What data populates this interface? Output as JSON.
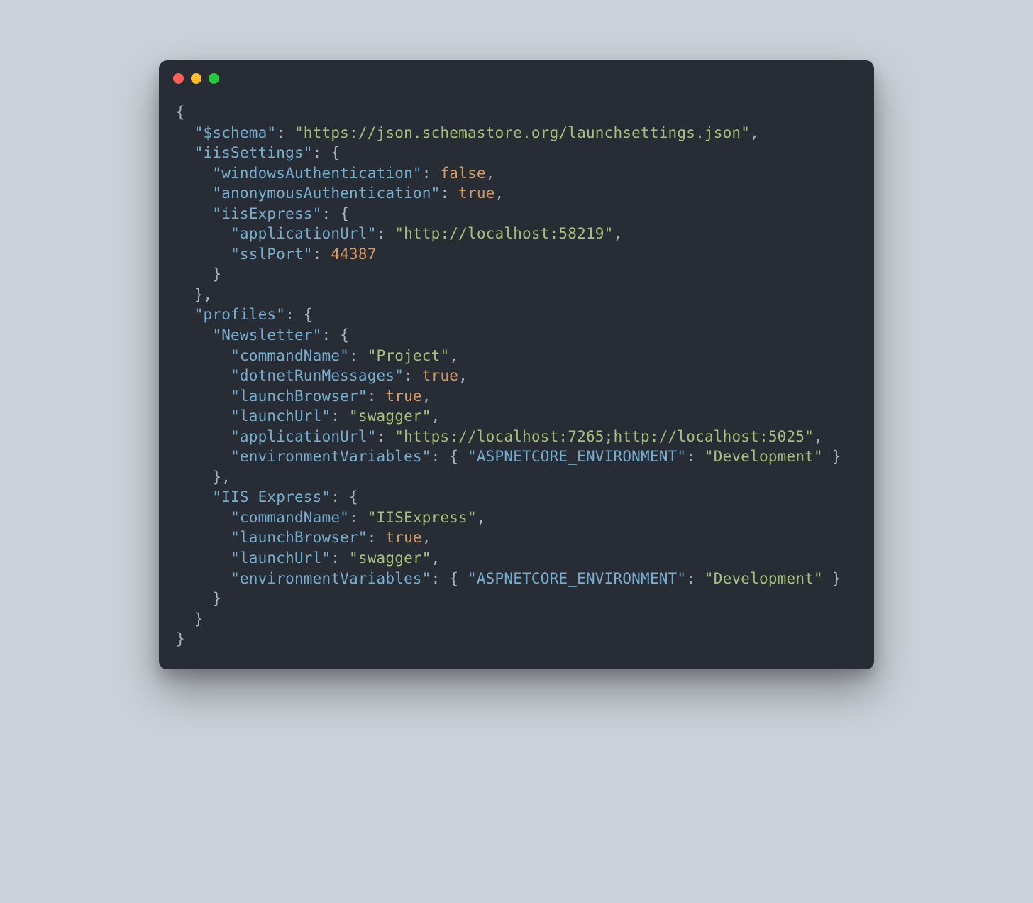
{
  "window": {
    "dots": [
      "red",
      "yellow",
      "green"
    ]
  },
  "code": {
    "ind1": "  ",
    "ind2": "    ",
    "ind3": "      ",
    "brace_open": "{",
    "brace_close": "}",
    "bracket_content_open": "{ ",
    "bracket_content_close": " }",
    "colon_space": ": ",
    "comma": ",",
    "keys": {
      "schema": "\"$schema\"",
      "iisSettings": "\"iisSettings\"",
      "windowsAuthentication": "\"windowsAuthentication\"",
      "anonymousAuthentication": "\"anonymousAuthentication\"",
      "iisExpress": "\"iisExpress\"",
      "applicationUrl": "\"applicationUrl\"",
      "sslPort": "\"sslPort\"",
      "profiles": "\"profiles\"",
      "newsletter": "\"Newsletter\"",
      "commandName": "\"commandName\"",
      "dotnetRunMessages": "\"dotnetRunMessages\"",
      "launchBrowser": "\"launchBrowser\"",
      "launchUrl": "\"launchUrl\"",
      "environmentVariables": "\"environmentVariables\"",
      "aspnetcoreEnv": "\"ASPNETCORE_ENVIRONMENT\"",
      "iisExpressProfile": "\"IIS Express\""
    },
    "values": {
      "schemaUrl": "\"https://json.schemastore.org/launchsettings.json\"",
      "false": "false",
      "true": "true",
      "localhostUrl": "\"http://localhost:58219\"",
      "sslPortNum": "44387",
      "project": "\"Project\"",
      "swagger": "\"swagger\"",
      "appUrls": "\"https://localhost:7265;http://localhost:5025\"",
      "development": "\"Development\"",
      "iisExpressCmd": "\"IISExpress\""
    }
  }
}
